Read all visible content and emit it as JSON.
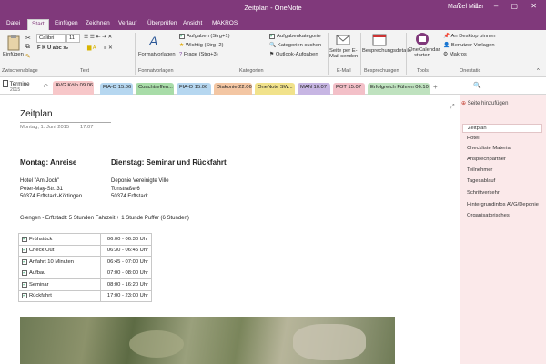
{
  "window": {
    "qat": "",
    "title": "Zeitplan - OneNote",
    "user": "Marcel Miller",
    "controls": "? ▭ – ▢ ✕"
  },
  "ribbon_tabs": [
    "Datei",
    "Start",
    "Einfügen",
    "Zeichnen",
    "Verlauf",
    "Überprüfen",
    "Ansicht",
    "MAKROS"
  ],
  "ribbon": {
    "paste_label": "Einfügen",
    "font_name": "Calibri",
    "font_size": "11",
    "format_buttons": "F  K  U  abc  x₂",
    "formatvorlagen": "Formatvorlagen",
    "tags": [
      "Aufgaben (Strg+1)",
      "Wichtig (Strg+2)",
      "Frage (Strg+3)"
    ],
    "aufgabenkategorie": "Aufgabenkategorie",
    "kategorien_suchen": "Kategorien suchen",
    "outlook_aufgaben": "Outlook-Aufgaben",
    "email_line1": "Seite per E-",
    "email_line2": "Mail senden",
    "meeting_details": "Besprechungsdetails",
    "onecal_line1": "OneCalendar",
    "onecal_line2": "starten",
    "dock": "An Desktop pinnen",
    "user_templates": "Benutzer Vorlagen",
    "makros": "Makros",
    "group_labels": {
      "clipboard": "Zwischenablage",
      "text": "Text",
      "styles": "Formatvorlagen",
      "tags": "Kategorien",
      "email": "E-Mail",
      "meetings": "Besprechungen",
      "tools": "Tools",
      "onestatic": "Onestatic"
    }
  },
  "notebook": {
    "name": "Termine",
    "year": "2015"
  },
  "section_tabs": [
    {
      "label": "AVG Köln 09.06",
      "color": "#f7c7c9"
    },
    {
      "label": "FIA-D 15.06",
      "color": "#b6d7f0"
    },
    {
      "label": "Coachtreffen...",
      "color": "#a8dca8"
    },
    {
      "label": "FIA-D 15.06",
      "color": "#b6d7f0"
    },
    {
      "label": "Diakonie 22.06",
      "color": "#f3c6a3"
    },
    {
      "label": "OneNote SW...",
      "color": "#f1e28b"
    },
    {
      "label": "MAN 10.07",
      "color": "#c7b6e3"
    },
    {
      "label": "POT 15.07",
      "color": "#f3c0c8"
    },
    {
      "label": "Erfolgreich Führen 06.10",
      "color": "#bfe2bf"
    }
  ],
  "page": {
    "title": "Zeitplan",
    "date": "Montag, 1. Juni 2015",
    "time": "17:07",
    "col1_heading": "Montag: Anreise",
    "col2_heading": "Dienstag: Seminar und Rückfahrt",
    "col1_address": [
      "Hotel \"Am Joch\"",
      "Peter-May-Str. 31",
      "50374 Erftstadt-Köttingen"
    ],
    "col2_address": [
      "Deponie Vereinigte Ville",
      "Tonstraße 6",
      "50374 Erftstadt"
    ],
    "route": "Giengen - Erftstadt: 5 Stunden Fahrzeit  + 1 Stunde Puffer (6  Stunden)",
    "schedule": [
      {
        "item": "Frühstück",
        "time": "06:00 - 06:30 Uhr"
      },
      {
        "item": "Check Out",
        "time": "06:30 - 06:45 Uhr"
      },
      {
        "item": "Anfahrt 10 Minuten",
        "time": "06:45 - 07:00 Uhr"
      },
      {
        "item": "Aufbau",
        "time": "07:00 - 08:00 Uhr"
      },
      {
        "item": "Seminar",
        "time": "08:00 - 16:20 Uhr"
      },
      {
        "item": "Rückfahrt",
        "time": "17:00 - 23:00 Uhr"
      }
    ]
  },
  "pages_panel": {
    "add_page": "Seite hinzufügen",
    "pages": [
      "Zeitplan",
      "Hotel",
      "Checkliste Material",
      "Ansprechpartner",
      "Teilnehmer",
      "Tagesablauf",
      "Schriftverkehr",
      "Hintergrundinfos AVG/Deponie",
      "Organisatorisches"
    ]
  }
}
